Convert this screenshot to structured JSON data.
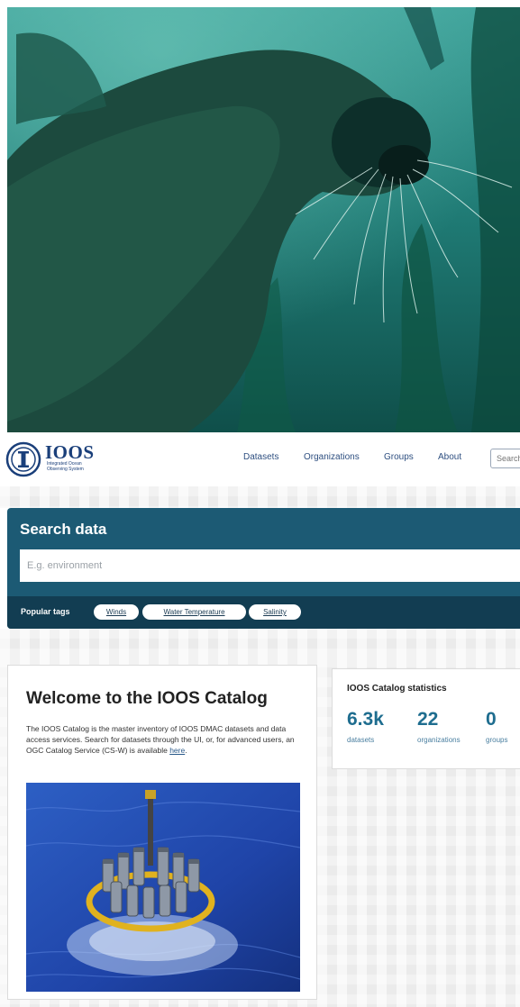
{
  "header": {
    "logo_name": "IOOS",
    "logo_subtitle": "Integrated Ocean Observing System",
    "nav": [
      "Datasets",
      "Organizations",
      "Groups",
      "About"
    ],
    "search_placeholder": "Search"
  },
  "search": {
    "title": "Search data",
    "placeholder": "E.g. environment",
    "popular_tags_label": "Popular tags",
    "tags": [
      "Winds",
      "Water Temperature",
      "Salinity"
    ]
  },
  "welcome": {
    "title": "Welcome to the IOOS Catalog",
    "text_before_link": "The IOOS Catalog is the master inventory of IOOS DMAC datasets and data access services. Search for datasets through the UI, or, for advanced users, an OGC Catalog Service (CS-W) is available ",
    "link_text": "here",
    "text_after_link": "."
  },
  "stats": {
    "title": "IOOS Catalog statistics",
    "items": [
      {
        "value": "6.3k",
        "label": "datasets"
      },
      {
        "value": "22",
        "label": "organizations"
      },
      {
        "value": "0",
        "label": "groups"
      }
    ]
  },
  "icons": {
    "logo": "ioos-emblem-icon",
    "hero_image": "sea-lion-photo",
    "buoy_image": "ocean-buoy-photo"
  },
  "colors": {
    "brand_navy": "#1a3f7a",
    "search_panel": "#1c5a74",
    "tags_bar": "#123d52",
    "stat_number": "#1e6d8f"
  }
}
